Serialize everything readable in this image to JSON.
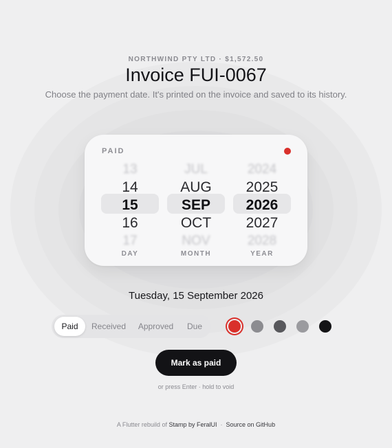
{
  "header": {
    "eyebrow": "NORTHWIND PTY LTD · $1,572.50",
    "title": "Invoice FUI-0067",
    "subtitle": "Choose the payment date. It's printed on the invoice and saved to its history."
  },
  "picker": {
    "label": "PAID",
    "status_color": "#d9302b",
    "columns": {
      "day": {
        "label": "DAY",
        "rows": [
          "13",
          "14",
          "15",
          "16",
          "17"
        ],
        "selected": "15"
      },
      "month": {
        "label": "MONTH",
        "rows": [
          "JUL",
          "AUG",
          "SEP",
          "OCT",
          "NOV"
        ],
        "selected": "SEP"
      },
      "year": {
        "label": "YEAR",
        "rows": [
          "2024",
          "2025",
          "2026",
          "2027",
          "2028"
        ],
        "selected": "2026"
      }
    }
  },
  "selected_date": "Tuesday, 15 September 2026",
  "status_tabs": [
    {
      "label": "Paid",
      "active": true
    },
    {
      "label": "Received",
      "active": false
    },
    {
      "label": "Approved",
      "active": false
    },
    {
      "label": "Due",
      "active": false
    }
  ],
  "swatches": [
    {
      "name": "red",
      "color": "#d9302b",
      "selected": true
    },
    {
      "name": "gray",
      "color": "#8c8c90",
      "selected": false
    },
    {
      "name": "dark-gray",
      "color": "#58585c",
      "selected": false
    },
    {
      "name": "light-gray",
      "color": "#9b9b9f",
      "selected": false
    },
    {
      "name": "black",
      "color": "#141416",
      "selected": false
    }
  ],
  "action": {
    "button_label": "Mark as paid",
    "hint": "or press Enter · hold to void"
  },
  "footer": {
    "prefix": "A Flutter rebuild of",
    "stamp_link": "Stamp by FeralUI",
    "separator": "·",
    "source_link": "Source on GitHub"
  }
}
